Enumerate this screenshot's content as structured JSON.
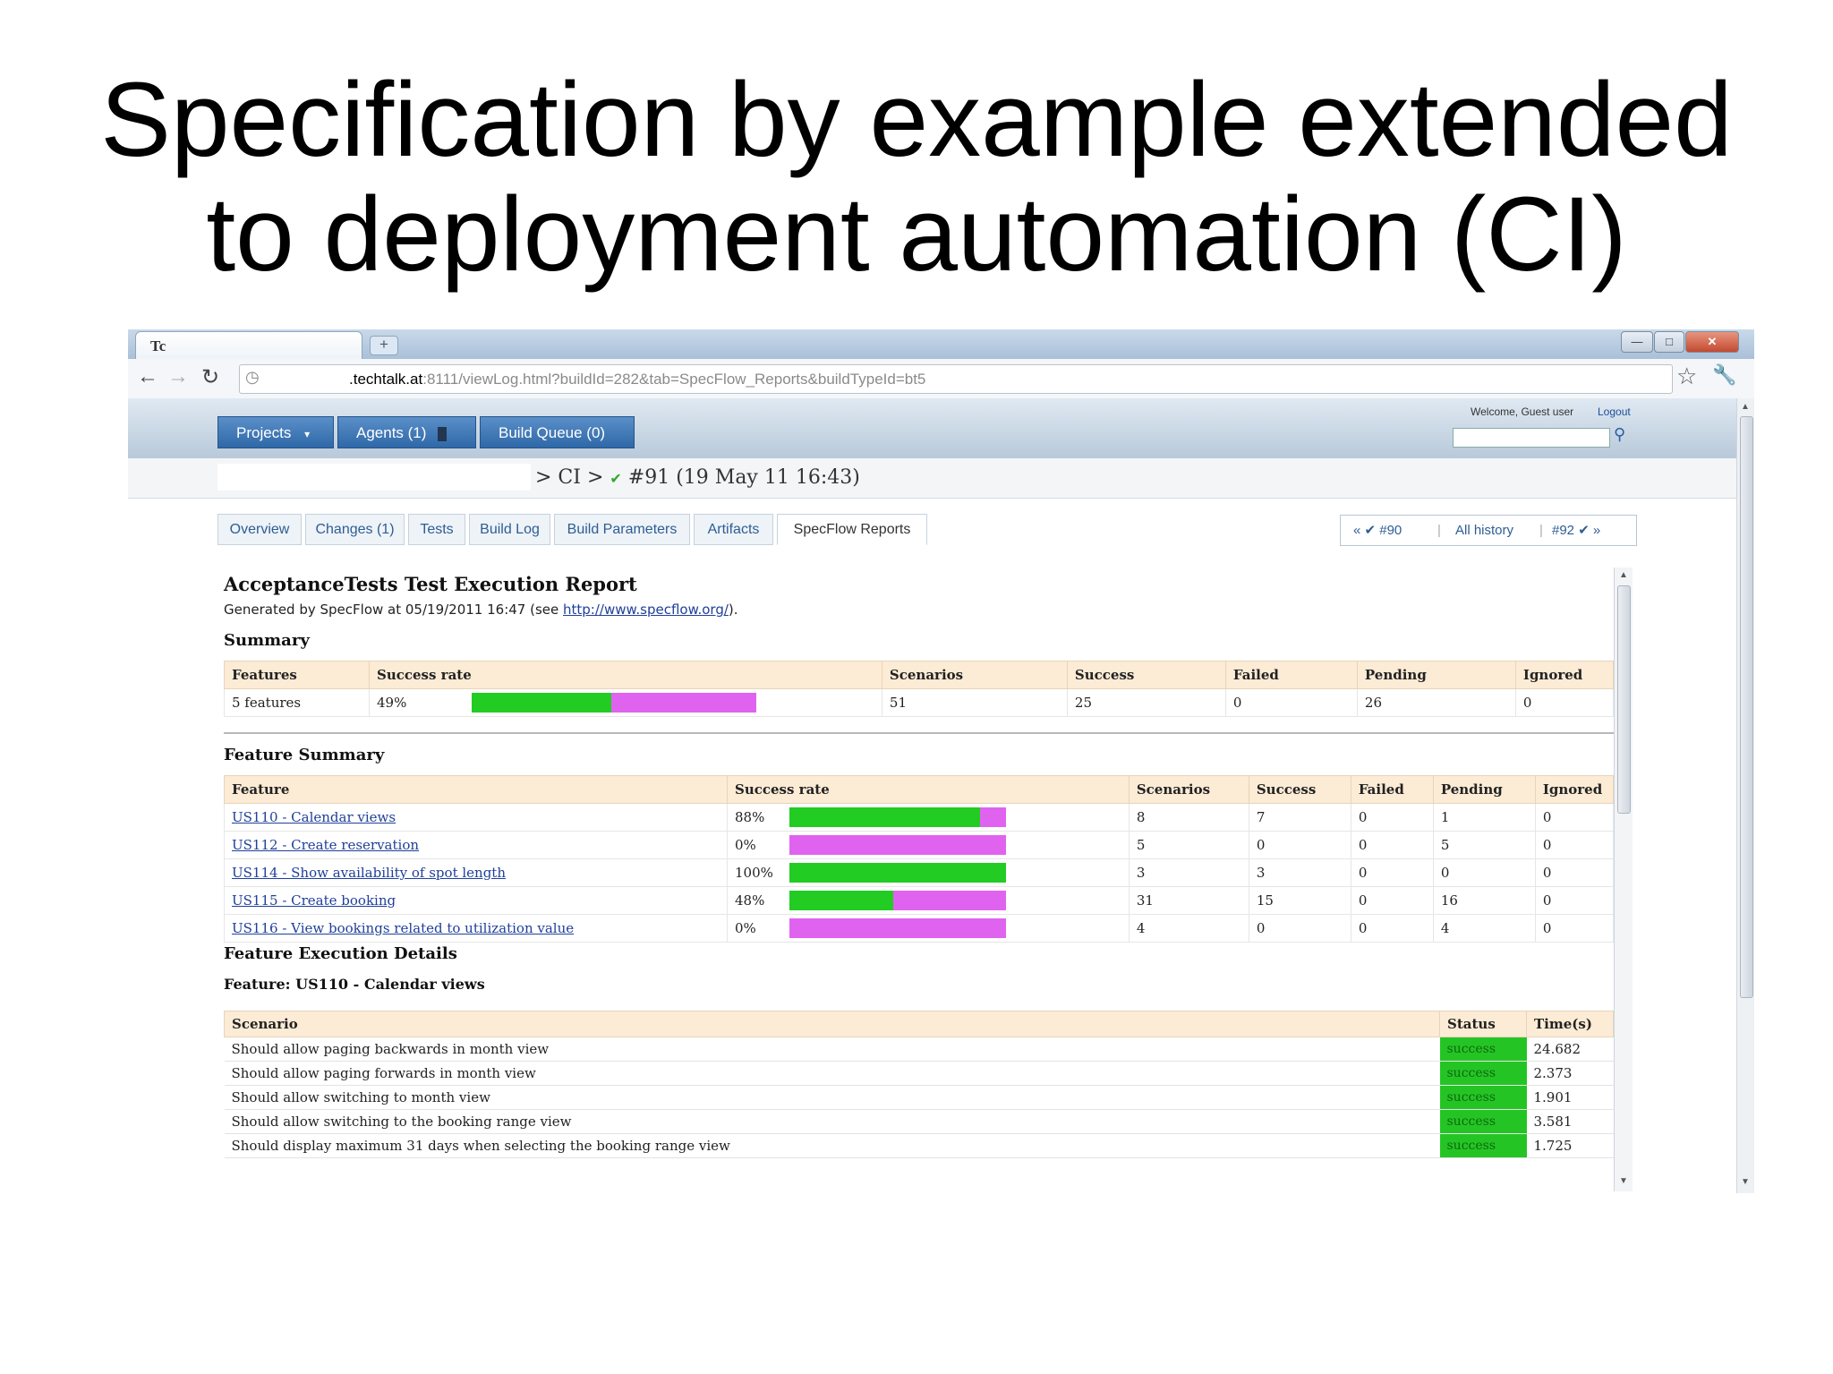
{
  "slide": {
    "title_line1": "Specification by example extended",
    "title_line2": "to deployment automation (CI)"
  },
  "browser": {
    "tab_icon": "Tc",
    "url_host": ".techtalk.at",
    "url_rest": ":8111/viewLog.html?buildId=282&tab=SpecFlow_Reports&buildTypeId=bt5"
  },
  "teamcity": {
    "nav": [
      "Projects",
      "Agents (1)",
      "Build Queue (0)"
    ],
    "welcome": "Welcome, Guest user",
    "logout": "Logout",
    "breadcrumb_ci": "> CI >",
    "breadcrumb_build": "#91 (19 May 11 16:43)",
    "tabs": [
      "Overview",
      "Changes (1)",
      "Tests",
      "Build Log",
      "Build Parameters",
      "Artifacts",
      "SpecFlow Reports"
    ],
    "active_tab": "SpecFlow Reports",
    "history": {
      "prev": "« ✔ #90",
      "all": "All history",
      "next": "#92 ✔ »"
    }
  },
  "report": {
    "title": "AcceptanceTests Test Execution Report",
    "generated_prefix": "Generated by SpecFlow at 05/19/2011 16:47 (see ",
    "generated_link": "http://www.specflow.org/",
    "generated_suffix": ").",
    "summary_heading": "Summary",
    "summary_headers": [
      "Features",
      "Success rate",
      "Scenarios",
      "Success",
      "Failed",
      "Pending",
      "Ignored"
    ],
    "summary_row": {
      "features": "5 features",
      "success_rate": "49%",
      "success_fraction": 0.49,
      "scenarios": "51",
      "success": "25",
      "failed": "0",
      "pending": "26",
      "ignored": "0"
    },
    "feature_summary_heading": "Feature Summary",
    "feature_headers": [
      "Feature",
      "Success rate",
      "Scenarios",
      "Success",
      "Failed",
      "Pending",
      "Ignored"
    ],
    "features": [
      {
        "name": "US110 - Calendar views",
        "rate": "88%",
        "fraction": 0.88,
        "scenarios": "8",
        "success": "7",
        "failed": "0",
        "pending": "1",
        "ignored": "0"
      },
      {
        "name": "US112 - Create reservation",
        "rate": "0%",
        "fraction": 0.0,
        "scenarios": "5",
        "success": "0",
        "failed": "0",
        "pending": "5",
        "ignored": "0"
      },
      {
        "name": "US114 - Show availability of spot length",
        "rate": "100%",
        "fraction": 1.0,
        "scenarios": "3",
        "success": "3",
        "failed": "0",
        "pending": "0",
        "ignored": "0"
      },
      {
        "name": "US115 - Create booking",
        "rate": "48%",
        "fraction": 0.48,
        "scenarios": "31",
        "success": "15",
        "failed": "0",
        "pending": "16",
        "ignored": "0"
      },
      {
        "name": "US116 - View bookings related to utilization value",
        "rate": "0%",
        "fraction": 0.0,
        "scenarios": "4",
        "success": "0",
        "failed": "0",
        "pending": "4",
        "ignored": "0"
      }
    ],
    "details_heading": "Feature Execution Details",
    "feature_detail_title": "Feature: US110 - Calendar views",
    "scenario_headers": [
      "Scenario",
      "Status",
      "Time(s)"
    ],
    "scenarios": [
      {
        "name": "Should allow paging backwards in month view",
        "status": "success",
        "time": "24.682"
      },
      {
        "name": "Should allow paging forwards in month view",
        "status": "success",
        "time": "2.373"
      },
      {
        "name": "Should allow switching to month view",
        "status": "success",
        "time": "1.901"
      },
      {
        "name": "Should allow switching to the booking range view",
        "status": "success",
        "time": "3.581"
      },
      {
        "name": "Should display maximum 31 days when selecting the booking range view",
        "status": "success",
        "time": "1.725"
      }
    ]
  }
}
